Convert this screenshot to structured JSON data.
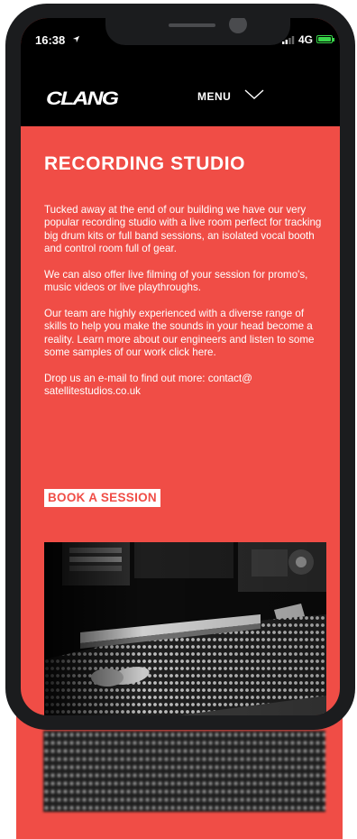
{
  "status_bar": {
    "time": "16:38",
    "network": "4G"
  },
  "header": {
    "logo": "CLANG",
    "menu_label": "MENU"
  },
  "page": {
    "title": "RECORDING STUDIO",
    "paragraphs": [
      "Tucked away at the end of our building we have our very popular recording studio with a live room perfect for tracking big drum kits or full band sessions, an isolated vocal booth and control room full of gear.",
      "We can also offer live filming of your session for promo's, music videos or live playthroughs.",
      "Our team are highly experienced with a diverse range of skills to help you make the sounds in your head become a reality. Learn more about our engineers and listen to some some samples of our work click here.",
      "Drop us an e-mail to find out more: contact@ satellitestudios.co.uk"
    ],
    "cta_label": "BOOK A SESSION"
  },
  "colors": {
    "brand": "#f04d46",
    "header": "#000000",
    "battery": "#39d64a"
  },
  "icons": [
    "location-arrow-icon",
    "signal-icon",
    "battery-icon",
    "chevron-down-icon"
  ]
}
